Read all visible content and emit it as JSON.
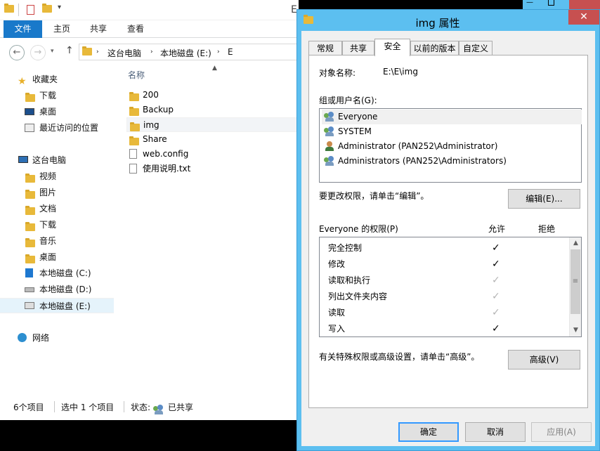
{
  "explorer": {
    "title_partial": "E",
    "ribbon_tabs": [
      "文件",
      "主页",
      "共享",
      "查看"
    ],
    "address": {
      "crumbs": [
        "这台电脑",
        "本地磁盘 (E:)",
        "E"
      ]
    },
    "nav": {
      "favorites": "收藏夹",
      "fav_items": [
        "下载",
        "桌面",
        "最近访问的位置"
      ],
      "thispc": "这台电脑",
      "pc_items": [
        "视频",
        "图片",
        "文档",
        "下载",
        "音乐",
        "桌面",
        "本地磁盘 (C:)",
        "本地磁盘 (D:)",
        "本地磁盘 (E:)"
      ],
      "network": "网络"
    },
    "column_header": "名称",
    "files": [
      "200",
      "Backup",
      "img",
      "Share",
      "web.config",
      "使用说明.txt"
    ],
    "status": {
      "count": "6个项目",
      "selected": "选中 1 个项目",
      "state_label": "状态:",
      "state_value": "已共享"
    }
  },
  "dialog": {
    "title": "img 属性",
    "close_glyph": "✕",
    "tabs": [
      "常规",
      "共享",
      "安全",
      "以前的版本",
      "自定义"
    ],
    "active_tab": "安全",
    "object_name_label": "对象名称:",
    "object_name_value": "E:\\E\\img",
    "group_label": "组或用户名(G):",
    "users": [
      "Everyone",
      "SYSTEM",
      "Administrator (PAN252\\Administrator)",
      "Administrators (PAN252\\Administrators)"
    ],
    "edit_hint": "要更改权限，请单击“编辑”。",
    "edit_button": "编辑(E)...",
    "perm_header": "Everyone 的权限(P)",
    "allow_header": "允许",
    "deny_header": "拒绝",
    "permissions": [
      {
        "name": "完全控制",
        "allow": "✓"
      },
      {
        "name": "修改",
        "allow": "✓"
      },
      {
        "name": "读取和执行",
        "allow": "✓"
      },
      {
        "name": "列出文件夹内容",
        "allow": "✓"
      },
      {
        "name": "读取",
        "allow": "✓"
      },
      {
        "name": "写入",
        "allow": "✓"
      }
    ],
    "permission_state": [
      "explicit",
      "explicit",
      "inherited-dim",
      "inherited-dim",
      "inherited-dim",
      "explicit"
    ],
    "advanced_hint": "有关特殊权限或高级设置，请单击“高级”。",
    "advanced_button": "高级(V)",
    "ok_button": "确定",
    "cancel_button": "取消",
    "apply_button": "应用(A)"
  },
  "colors": {
    "dialog_frame": "#5cbff0",
    "file_tab": "#1979ca",
    "close_button": "#c75050"
  }
}
